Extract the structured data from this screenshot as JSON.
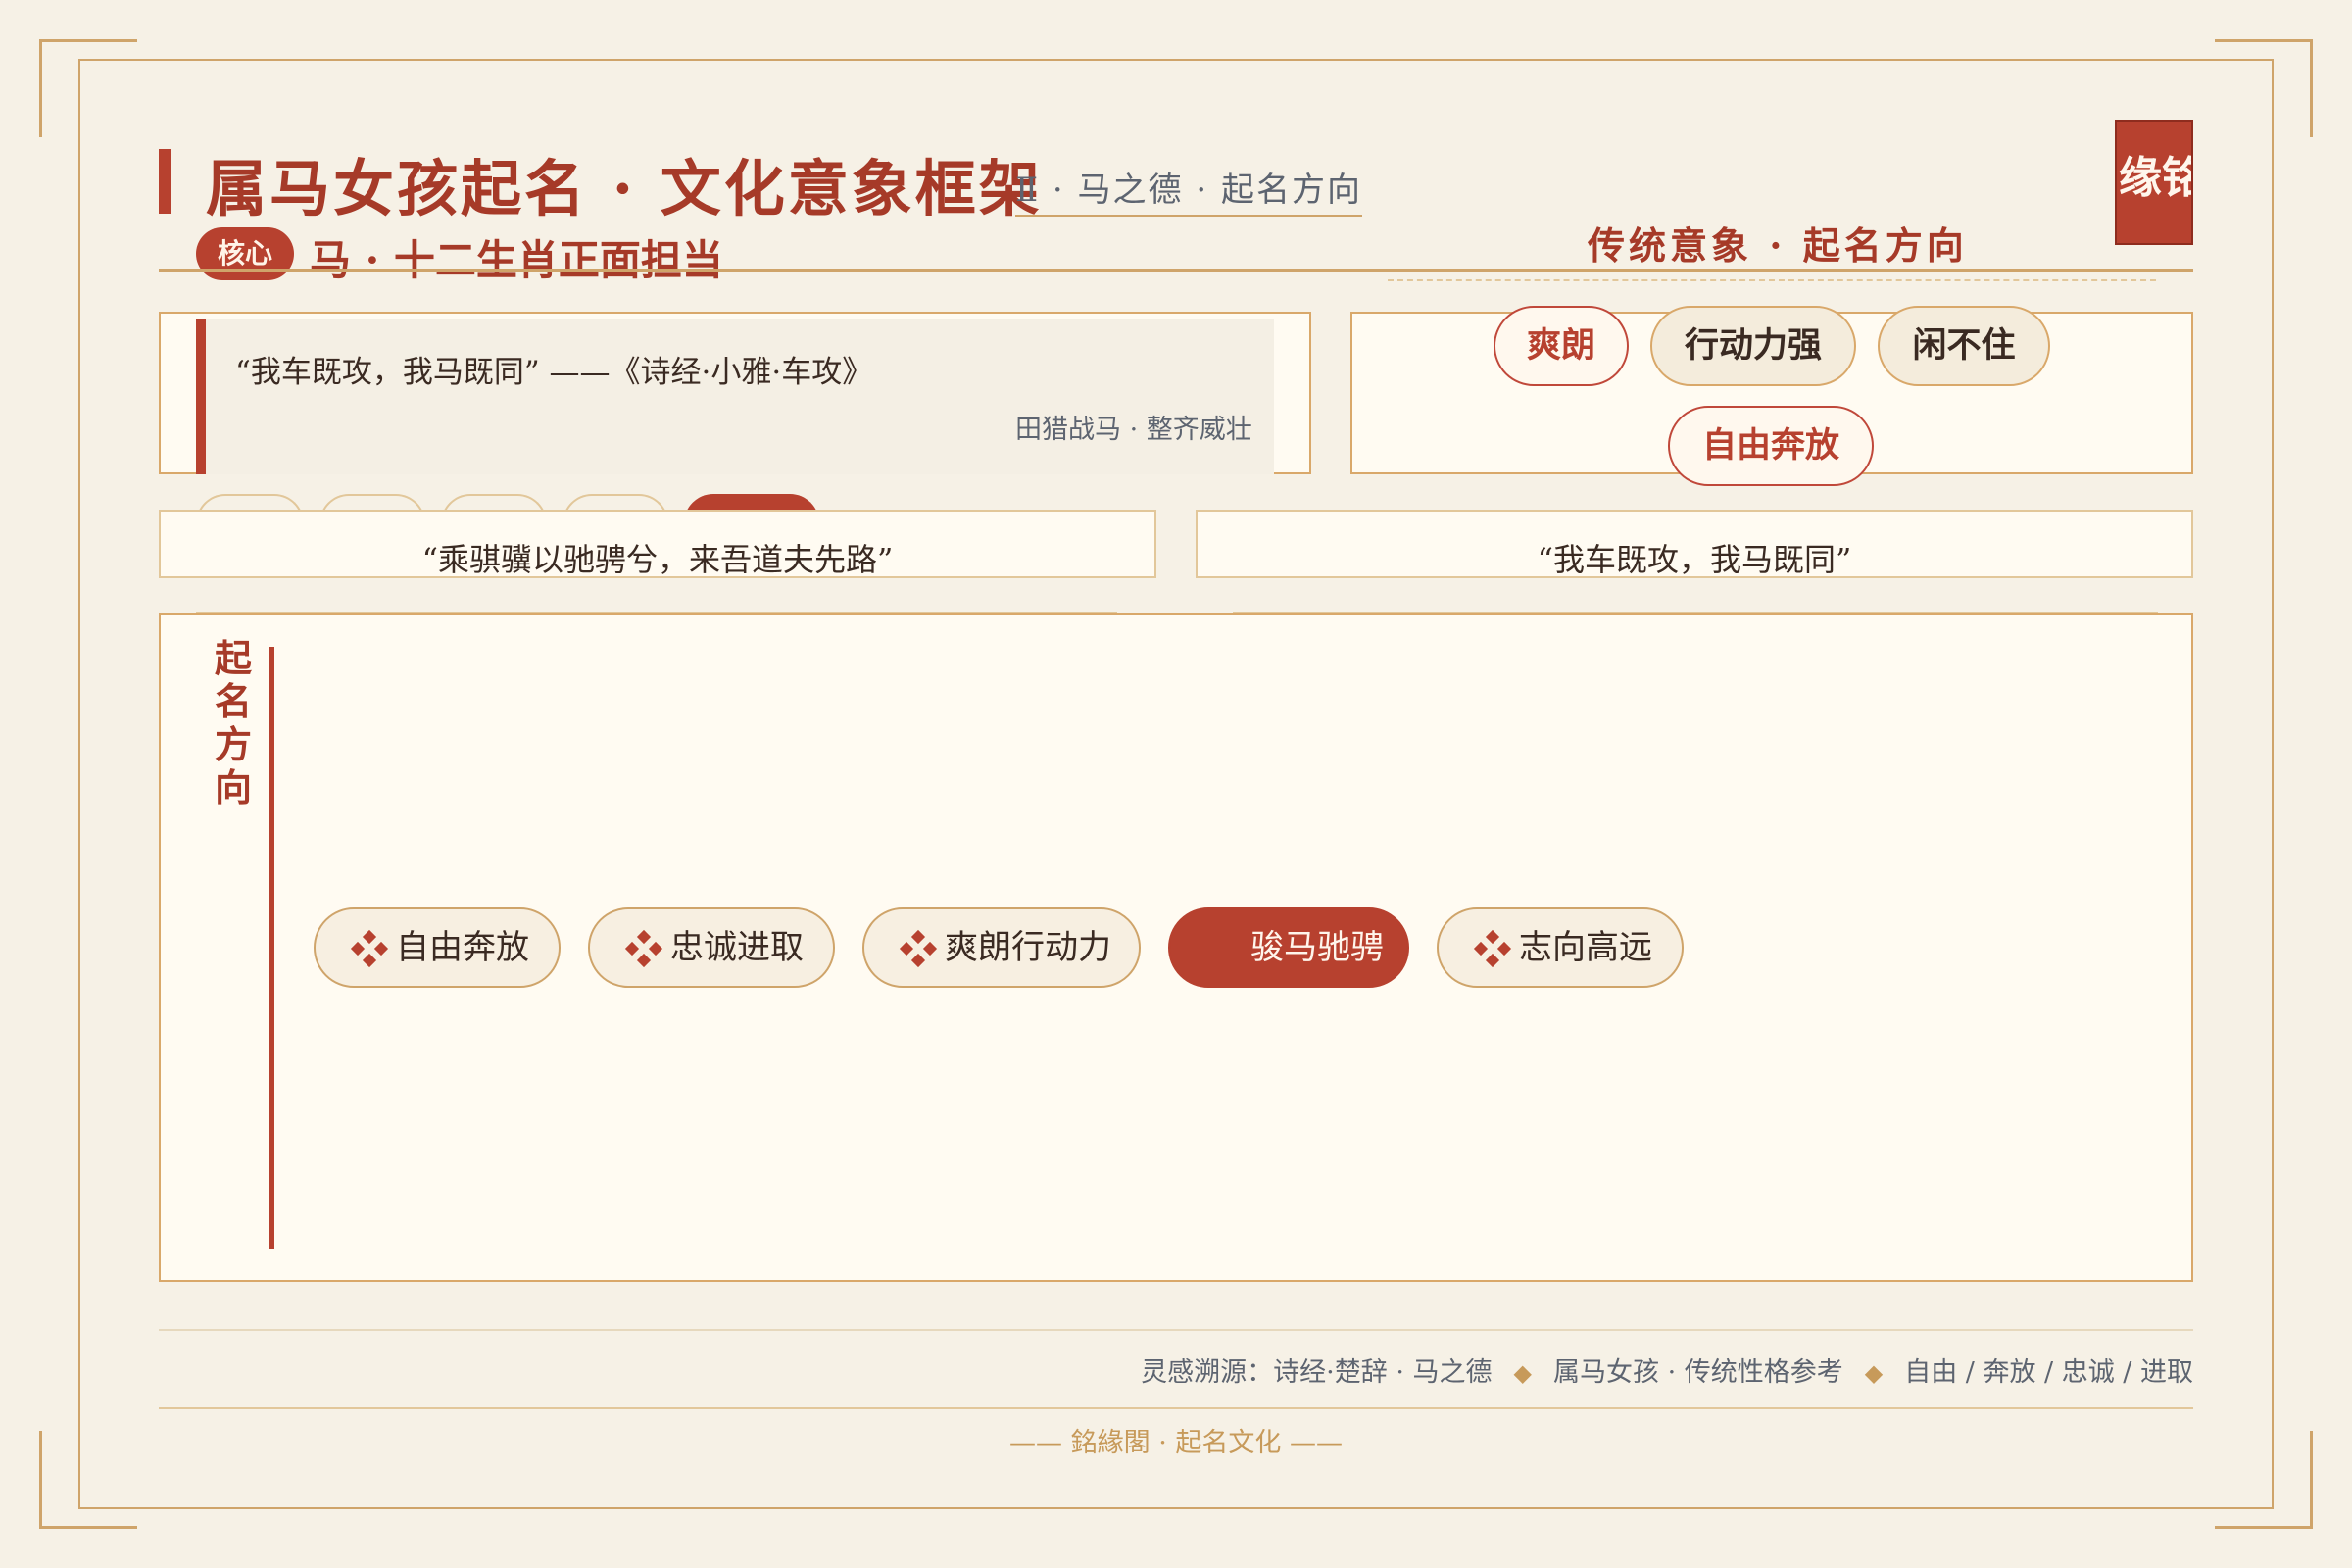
{
  "header": {
    "title": "属马女孩起名 · 文化意象框架",
    "subtitle": "Ⅱ · 马之德 · 起名方向",
    "seal": "缘铭"
  },
  "core": {
    "badge": "核心",
    "text": "马 · 十二生肖正面担当"
  },
  "traditional": {
    "title": "传统意象 · 起名方向",
    "pills": [
      "爽朗",
      "行动力强",
      "闲不住",
      "自由奔放"
    ]
  },
  "quote": {
    "text": "“我车既攻，我马既同” ——《诗经·小雅·车攻》",
    "note": "田猎战马 · 整齐威壮"
  },
  "verses": [
    "“乘骐骥以驰骋兮，来吾道夫先路”",
    "“我车既攻，我马既同”"
  ],
  "directions": {
    "label": "起名方向",
    "chips": [
      {
        "label": "自由奔放",
        "active": false
      },
      {
        "label": "忠诚进取",
        "active": false
      },
      {
        "label": "爽朗行动力",
        "active": false
      },
      {
        "label": "骏马驰骋",
        "active": true
      },
      {
        "label": "志向高远",
        "active": false
      }
    ]
  },
  "footer": {
    "parts": [
      "灵感溯源：诗经·楚辞 · 马之德",
      "属马女孩 · 传统性格参考",
      "自由 / 奔放 / 忠诚 / 进取"
    ],
    "separator": "◆",
    "brand": "—— 銘緣閣 · 起名文化 ——"
  },
  "colors": {
    "accent": "#b7412f",
    "gold": "#cfa46a",
    "background": "#f6f1e6",
    "panel": "#fffbf2"
  }
}
